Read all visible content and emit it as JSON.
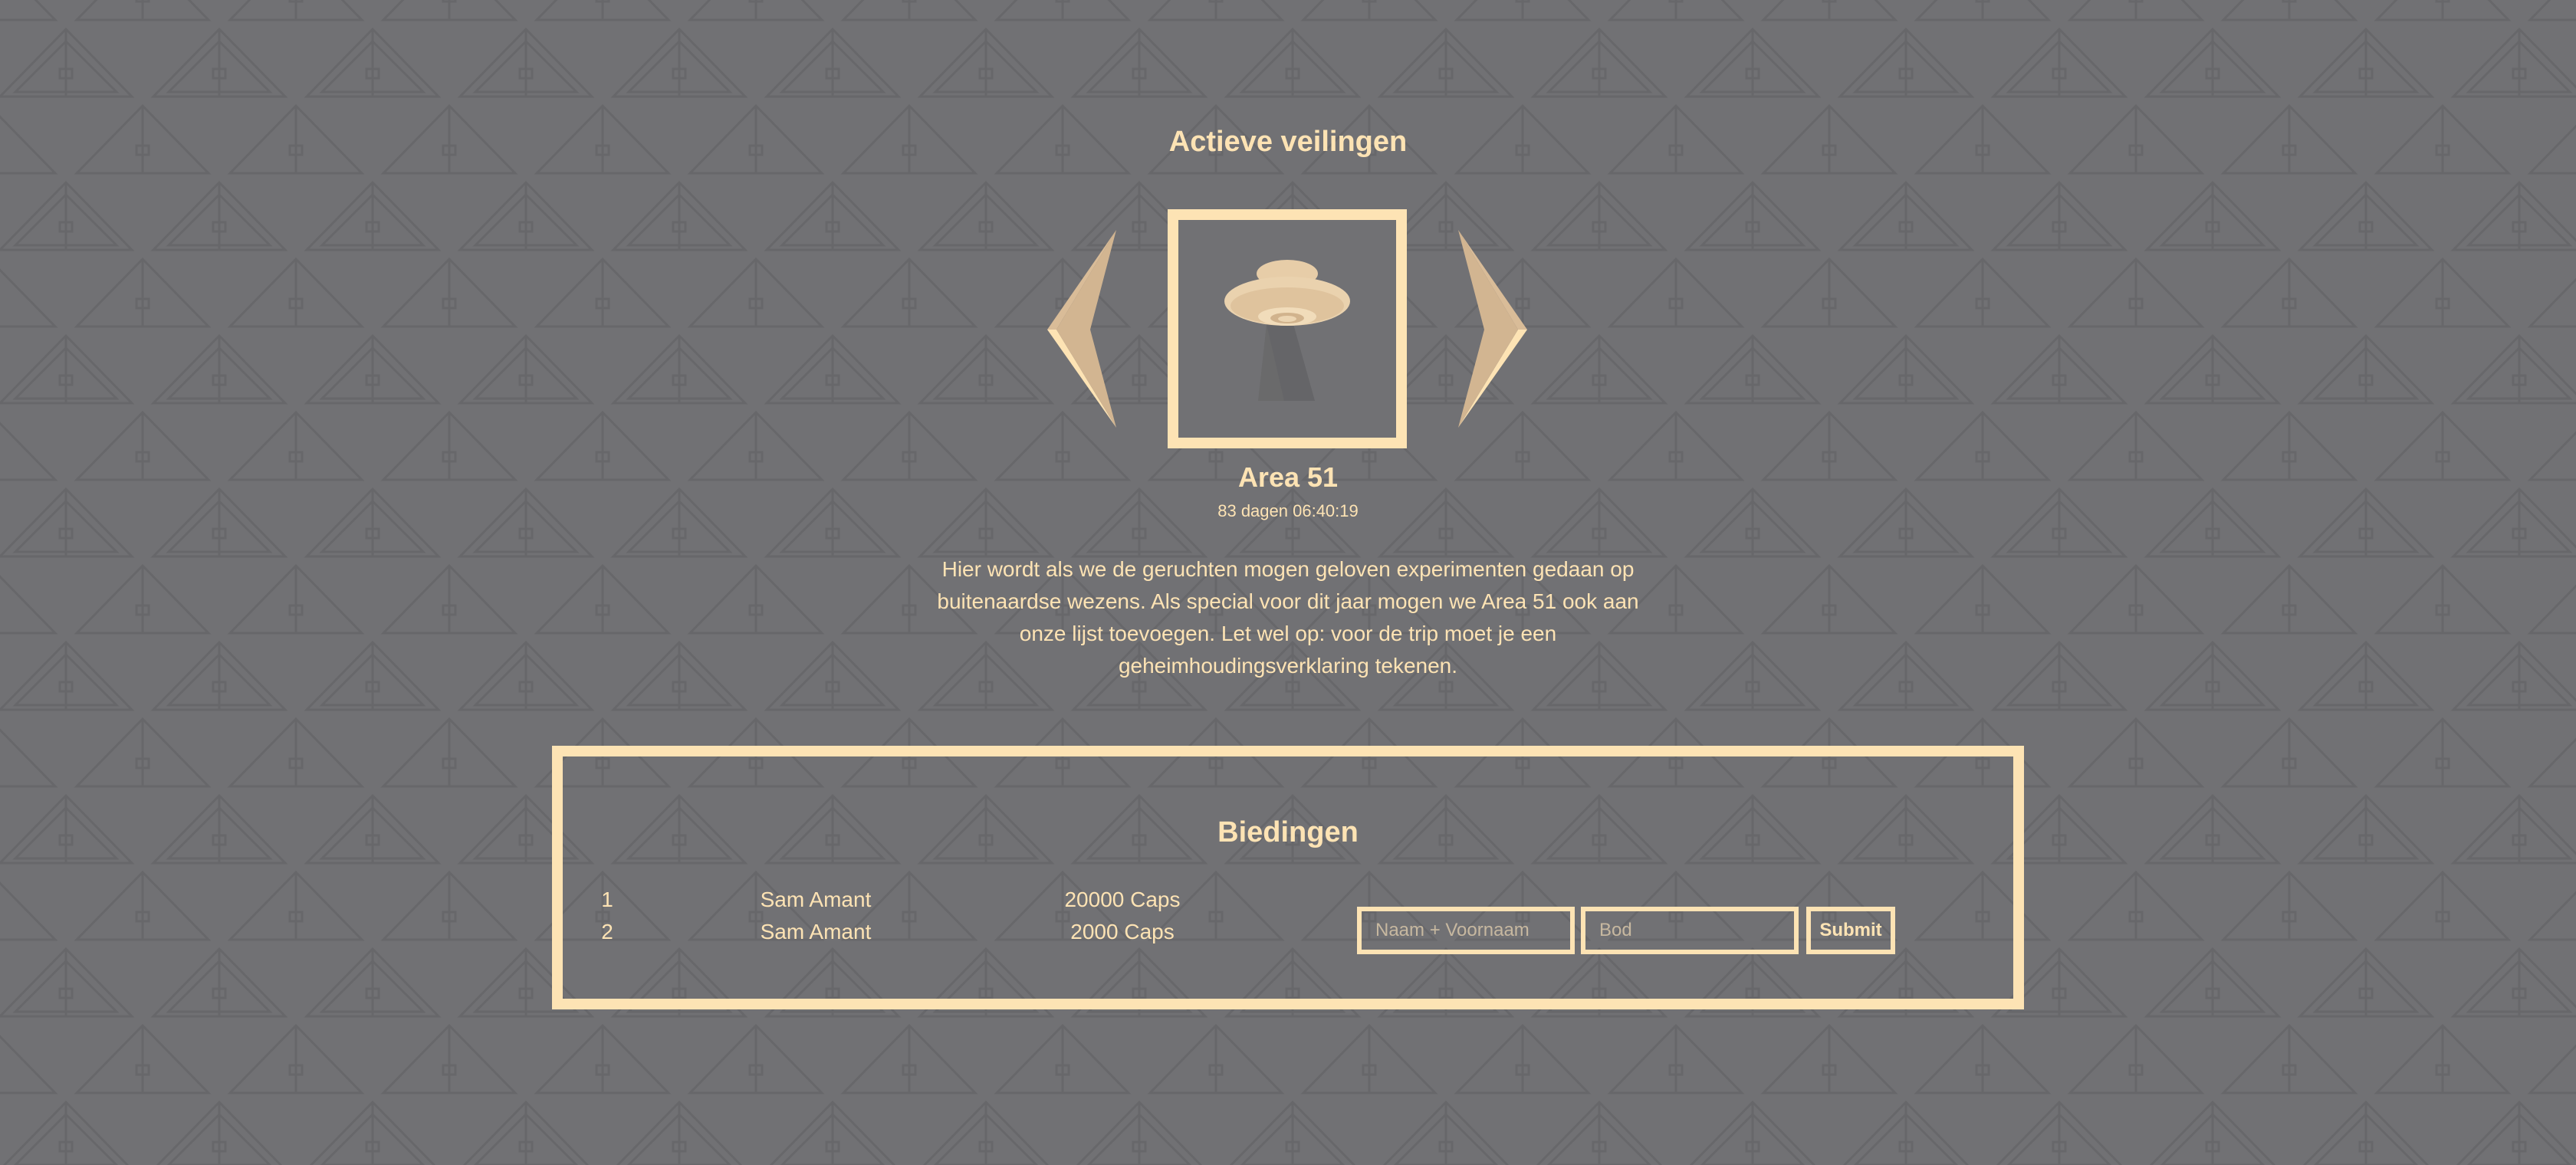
{
  "page": {
    "title": "Actieve veilingen"
  },
  "carousel": {
    "prev_icon": "chevron-left-icon",
    "next_icon": "chevron-right-icon",
    "image_icon": "ufo-icon"
  },
  "item": {
    "title": "Area 51",
    "countdown": "83 dagen 06:40:19",
    "description": "Hier wordt als we de geruchten mogen geloven experimenten gedaan op buitenaardse wezens. Als special voor dit jaar mogen we Area 51 ook aan onze lijst toevoegen. Let wel op: voor de trip moet je een geheimhoudingsverklaring tekenen."
  },
  "bids": {
    "title": "Biedingen",
    "rows": [
      {
        "rank": "1",
        "name": "Sam Amant",
        "amount": "20000 Caps"
      },
      {
        "rank": "2",
        "name": "Sam Amant",
        "amount": "2000 Caps"
      }
    ],
    "form": {
      "name_placeholder": "Naam + Voornaam",
      "bid_placeholder": "Bod",
      "submit_label": "Submit"
    }
  },
  "colors": {
    "background": "#717174",
    "accent": "#fde3b4",
    "pattern": "#66666a"
  }
}
